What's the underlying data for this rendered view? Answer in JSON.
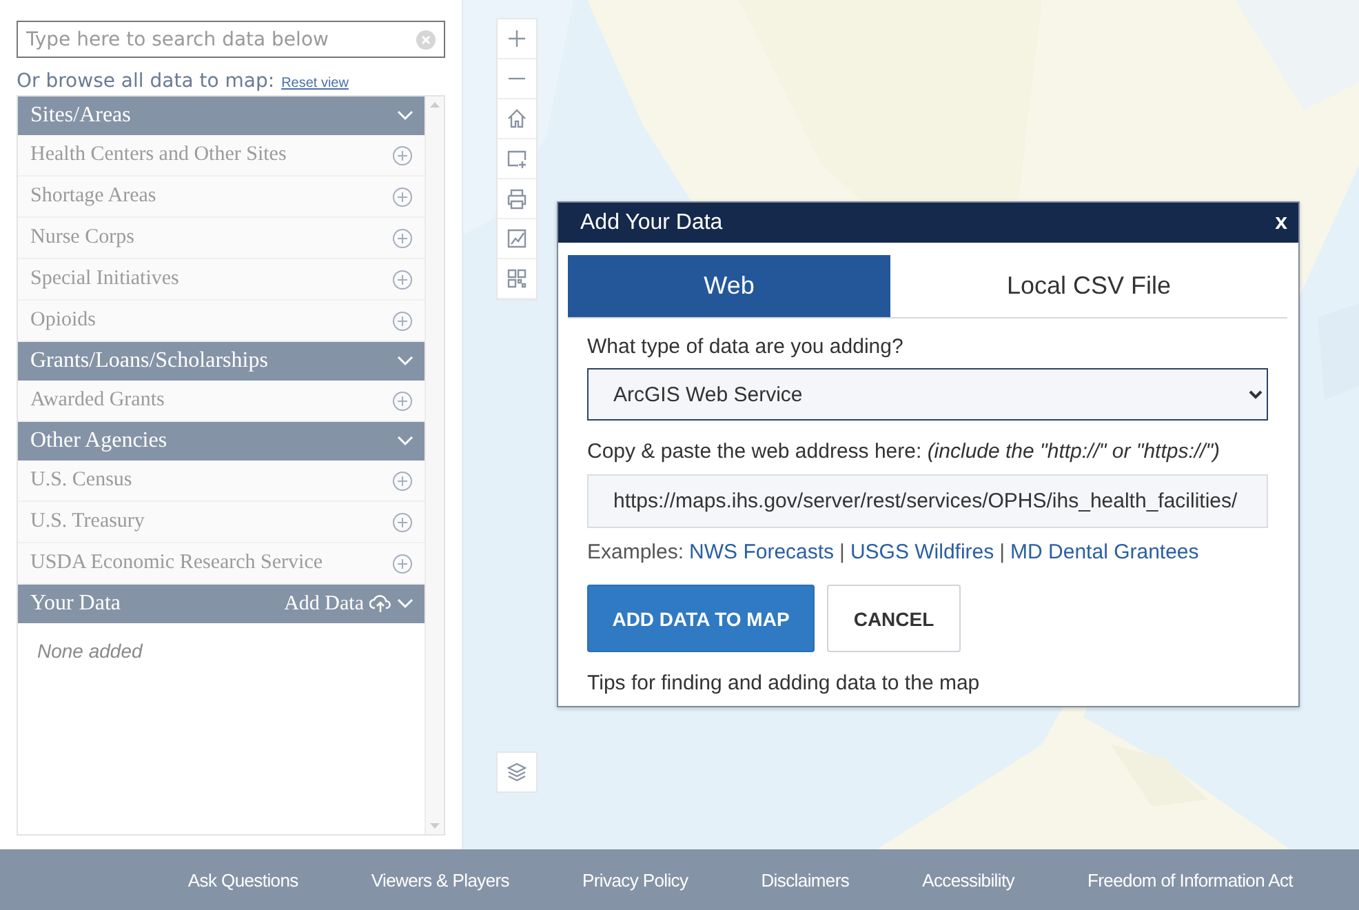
{
  "search": {
    "placeholder": "Type here to search data below"
  },
  "browse": {
    "label": "Or browse all data to map:",
    "reset_link": "Reset view"
  },
  "sections": [
    {
      "title": "Sites/Areas",
      "items": [
        "Health Centers and Other Sites",
        "Shortage Areas",
        "Nurse Corps",
        "Special Initiatives",
        "Opioids"
      ]
    },
    {
      "title": "Grants/Loans/Scholarships",
      "items": [
        "Awarded Grants"
      ]
    },
    {
      "title": "Other Agencies",
      "items": [
        "U.S. Census",
        "U.S. Treasury",
        "USDA Economic Research Service"
      ]
    },
    {
      "title": "Your Data",
      "action": "Add Data",
      "empty_text": "None added"
    }
  ],
  "dialog": {
    "title": "Add Your Data",
    "close": "x",
    "tabs": [
      {
        "label": "Web",
        "selected": true
      },
      {
        "label": "Local CSV File",
        "selected": false
      }
    ],
    "type_label": "What type of data are you adding?",
    "type_value": "ArcGIS Web Service",
    "url_label": "Copy & paste the web address here: *(include the \"http://\" or \"https://\")*",
    "url_value": "https://maps.ihs.gov/server/rest/services/OPHS/ihs_health_facilities/",
    "examples_label": "Examples:",
    "separator": "|",
    "examples": [
      "NWS Forecasts",
      "USGS Wildfires",
      "MD Dental Grantees"
    ],
    "buttons": [
      {
        "label": "ADD DATA TO MAP",
        "kind": "primary"
      },
      {
        "label": "CANCEL",
        "kind": "secondary"
      }
    ],
    "tips": "Tips for finding and adding data to the map"
  },
  "footer": {
    "links": [
      "Ask Questions",
      "Viewers & Players",
      "Privacy Policy",
      "Disclaimers",
      "Accessibility",
      "Freedom of Information Act"
    ]
  }
}
